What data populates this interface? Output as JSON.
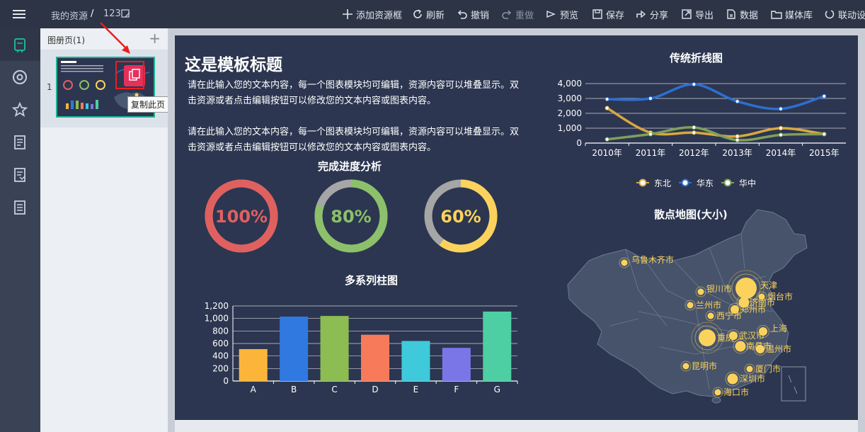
{
  "topbar": {
    "breadcrumb_root": "我的资源",
    "breadcrumb_sep": "/",
    "breadcrumb_item": "123",
    "tools": [
      {
        "label": "添加资源框",
        "icon": "plus-icon"
      },
      {
        "label": "刷新",
        "icon": "refresh-icon"
      },
      {
        "label": "撤销",
        "icon": "undo-icon"
      },
      {
        "label": "重做",
        "icon": "redo-icon"
      },
      {
        "label": "预览",
        "icon": "eye-icon"
      },
      {
        "label": "保存",
        "icon": "save-icon"
      },
      {
        "label": "分享",
        "icon": "share-icon"
      },
      {
        "label": "导出",
        "icon": "export-icon"
      },
      {
        "label": "数据",
        "icon": "data-icon"
      },
      {
        "label": "媒体库",
        "icon": "folder-icon"
      },
      {
        "label": "联动设",
        "icon": "link-icon"
      }
    ]
  },
  "pages_panel": {
    "header": "图册页(1)",
    "add": "+",
    "page_number": "1",
    "tooltip": "复制此页"
  },
  "slide": {
    "title": "这是模板标题",
    "para1": "请在此输入您的文本内容，每一个图表模块均可编辑，资源内容可以堆叠显示。双击资源或者点击编辑按钮可以修改您的文本内容或图表内容。",
    "para2": "请在此输入您的文本内容，每一个图表模块均可编辑，资源内容可以堆叠显示。双击资源或者点击编辑按钮可以修改您的文本内容或图表内容。",
    "progress_title": "完成进度分析",
    "bar_title": "多系列柱图",
    "line_title": "传统折线图",
    "map_title": "散点地图(大小)"
  },
  "colors": {
    "slide_bg": "#2c3650",
    "accent": "#1db394"
  },
  "chart_data": [
    {
      "type": "gauge",
      "title": "完成进度分析",
      "items": [
        {
          "label": "100%",
          "value": 100,
          "color": "#e06060"
        },
        {
          "label": "80%",
          "value": 80,
          "color": "#8cc06a"
        },
        {
          "label": "60%",
          "value": 60,
          "color": "#fbd35c"
        }
      ]
    },
    {
      "type": "bar",
      "title": "多系列柱图",
      "categories": [
        "A",
        "B",
        "C",
        "D",
        "E",
        "F",
        "G"
      ],
      "values": [
        510,
        1030,
        1040,
        740,
        640,
        530,
        1110
      ],
      "colors": [
        "#fbb53a",
        "#2f79e0",
        "#8cbc52",
        "#f77a5a",
        "#3fcadb",
        "#7b76e8",
        "#4ecfa3"
      ],
      "ylim": [
        0,
        1200
      ],
      "yticks": [
        "0",
        "200",
        "400",
        "600",
        "800",
        "1,000",
        "1,200"
      ]
    },
    {
      "type": "line",
      "title": "传统折线图",
      "categories": [
        "2010年",
        "2011年",
        "2012年",
        "2013年",
        "2014年",
        "2015年"
      ],
      "ylim": [
        0,
        4000
      ],
      "yticks": [
        "0",
        "1,000",
        "2,000",
        "3,000",
        "4,000"
      ],
      "series": [
        {
          "name": "东北",
          "values": [
            2350,
            700,
            700,
            450,
            1000,
            600
          ],
          "color": "#d8a840"
        },
        {
          "name": "华东",
          "values": [
            2950,
            3000,
            3950,
            2800,
            2300,
            3150
          ],
          "color": "#2e6fd0"
        },
        {
          "name": "华中",
          "values": [
            250,
            600,
            1050,
            200,
            550,
            600
          ],
          "color": "#7fa05a"
        }
      ],
      "legend": "bottom"
    },
    {
      "type": "scatter-map",
      "title": "散点地图(大小)",
      "cities": [
        {
          "name": "乌鲁木齐市",
          "size": 3
        },
        {
          "name": "银川市",
          "size": 3
        },
        {
          "name": "兰州市",
          "size": 3
        },
        {
          "name": "西宁市",
          "size": 3
        },
        {
          "name": "天津",
          "size": 10
        },
        {
          "name": "烟台市",
          "size": 3
        },
        {
          "name": "济南市",
          "size": 5
        },
        {
          "name": "郑州市",
          "size": 4
        },
        {
          "name": "重庆",
          "size": 8
        },
        {
          "name": "武汉市",
          "size": 4
        },
        {
          "name": "上海",
          "size": 4
        },
        {
          "name": "南昌市",
          "size": 5
        },
        {
          "name": "温州市",
          "size": 4
        },
        {
          "name": "昆明市",
          "size": 3
        },
        {
          "name": "厦门市",
          "size": 3
        },
        {
          "name": "深圳市",
          "size": 5
        },
        {
          "name": "海口市",
          "size": 3
        }
      ]
    }
  ]
}
